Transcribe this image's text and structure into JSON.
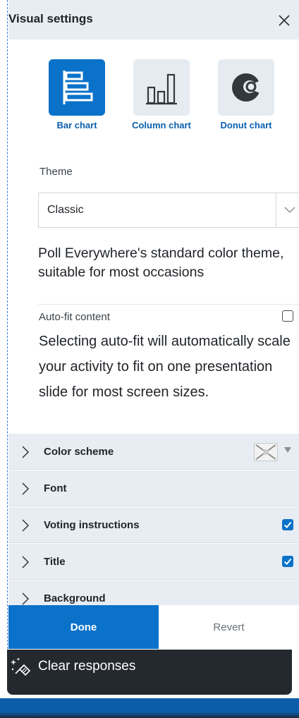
{
  "panel": {
    "title": "Visual settings",
    "close_icon": "close-icon"
  },
  "chart_types": [
    {
      "label": "Bar chart",
      "icon": "bar-chart-icon",
      "selected": true
    },
    {
      "label": "Column chart",
      "icon": "column-chart-icon",
      "selected": false
    },
    {
      "label": "Donut chart",
      "icon": "donut-chart-icon",
      "selected": false
    }
  ],
  "theme": {
    "label": "Theme",
    "value": "Classic",
    "description": "Poll Everywhere's standard color theme, suitable for most occasions"
  },
  "autofit": {
    "label": "Auto-fit content",
    "checked": false,
    "description": "Selecting auto-fit will automatically scale your activity to fit on one presentation slide for most screen sizes."
  },
  "sections": [
    {
      "label": "Color scheme",
      "control": "swatch"
    },
    {
      "label": "Font",
      "control": "none"
    },
    {
      "label": "Voting instructions",
      "control": "checkbox",
      "checked": true
    },
    {
      "label": "Title",
      "control": "checkbox",
      "checked": true
    },
    {
      "label": "Background",
      "control": "none"
    }
  ],
  "footer": {
    "done_label": "Done",
    "revert_label": "Revert"
  },
  "bottom_bar": {
    "label": "Clear responses",
    "icon": "broom-sparkle-icon"
  },
  "colors": {
    "accent": "#0b72c9",
    "header_bg": "#e8edf3",
    "dark_bar": "#24292f"
  }
}
